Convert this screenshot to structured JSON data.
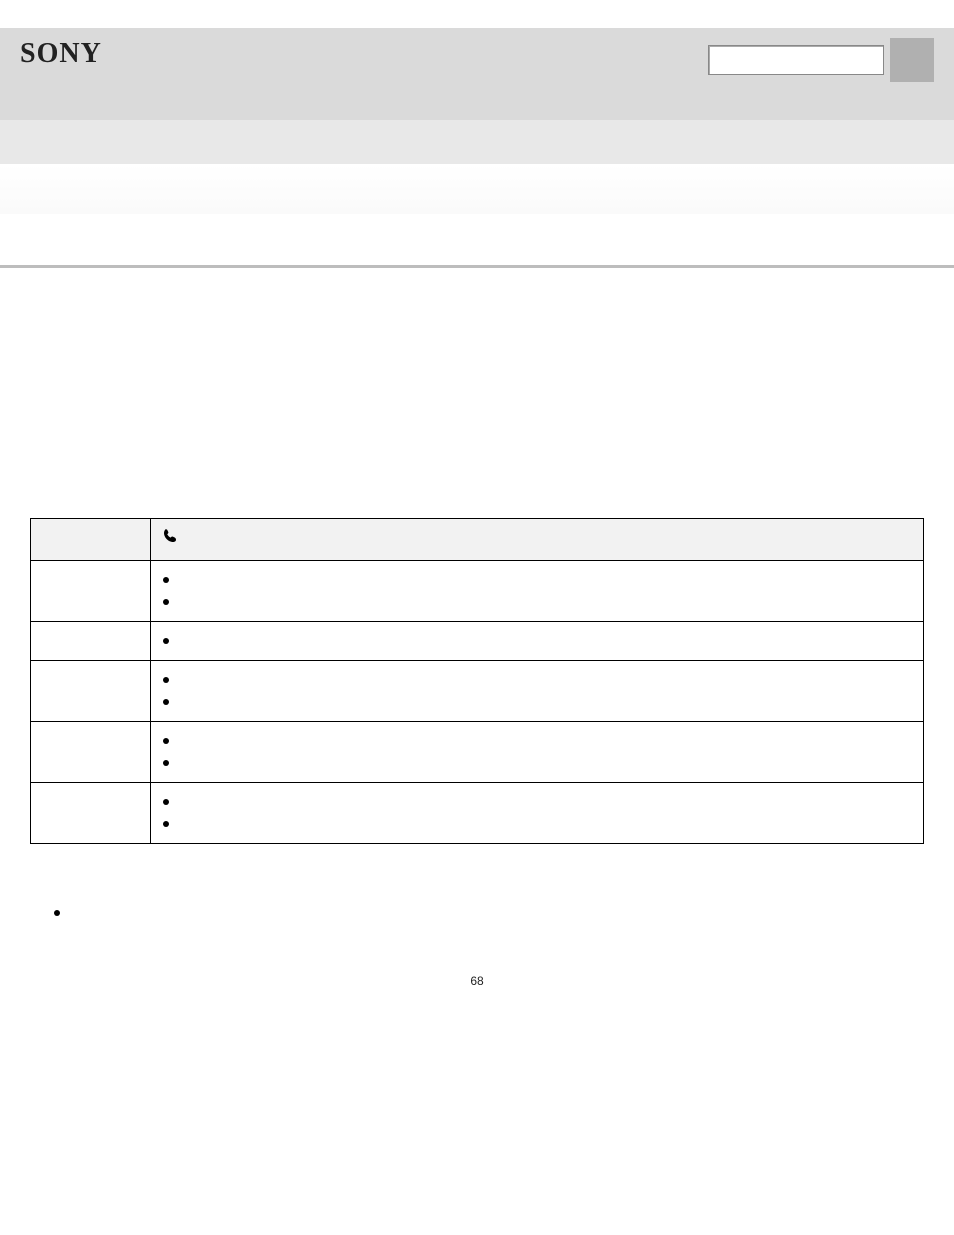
{
  "logo": "SONY",
  "search_placeholder": "",
  "page_number": "68",
  "table": {
    "header_icon": "phone-icon",
    "rows": [
      {
        "label": "",
        "items": [
          "",
          ""
        ]
      },
      {
        "label": "",
        "items": [
          ""
        ]
      },
      {
        "label": "",
        "items": [
          "",
          ""
        ]
      },
      {
        "label": "",
        "items": [
          "",
          ""
        ]
      },
      {
        "label": "",
        "items": [
          "",
          ""
        ]
      }
    ]
  },
  "notes": [
    ""
  ]
}
